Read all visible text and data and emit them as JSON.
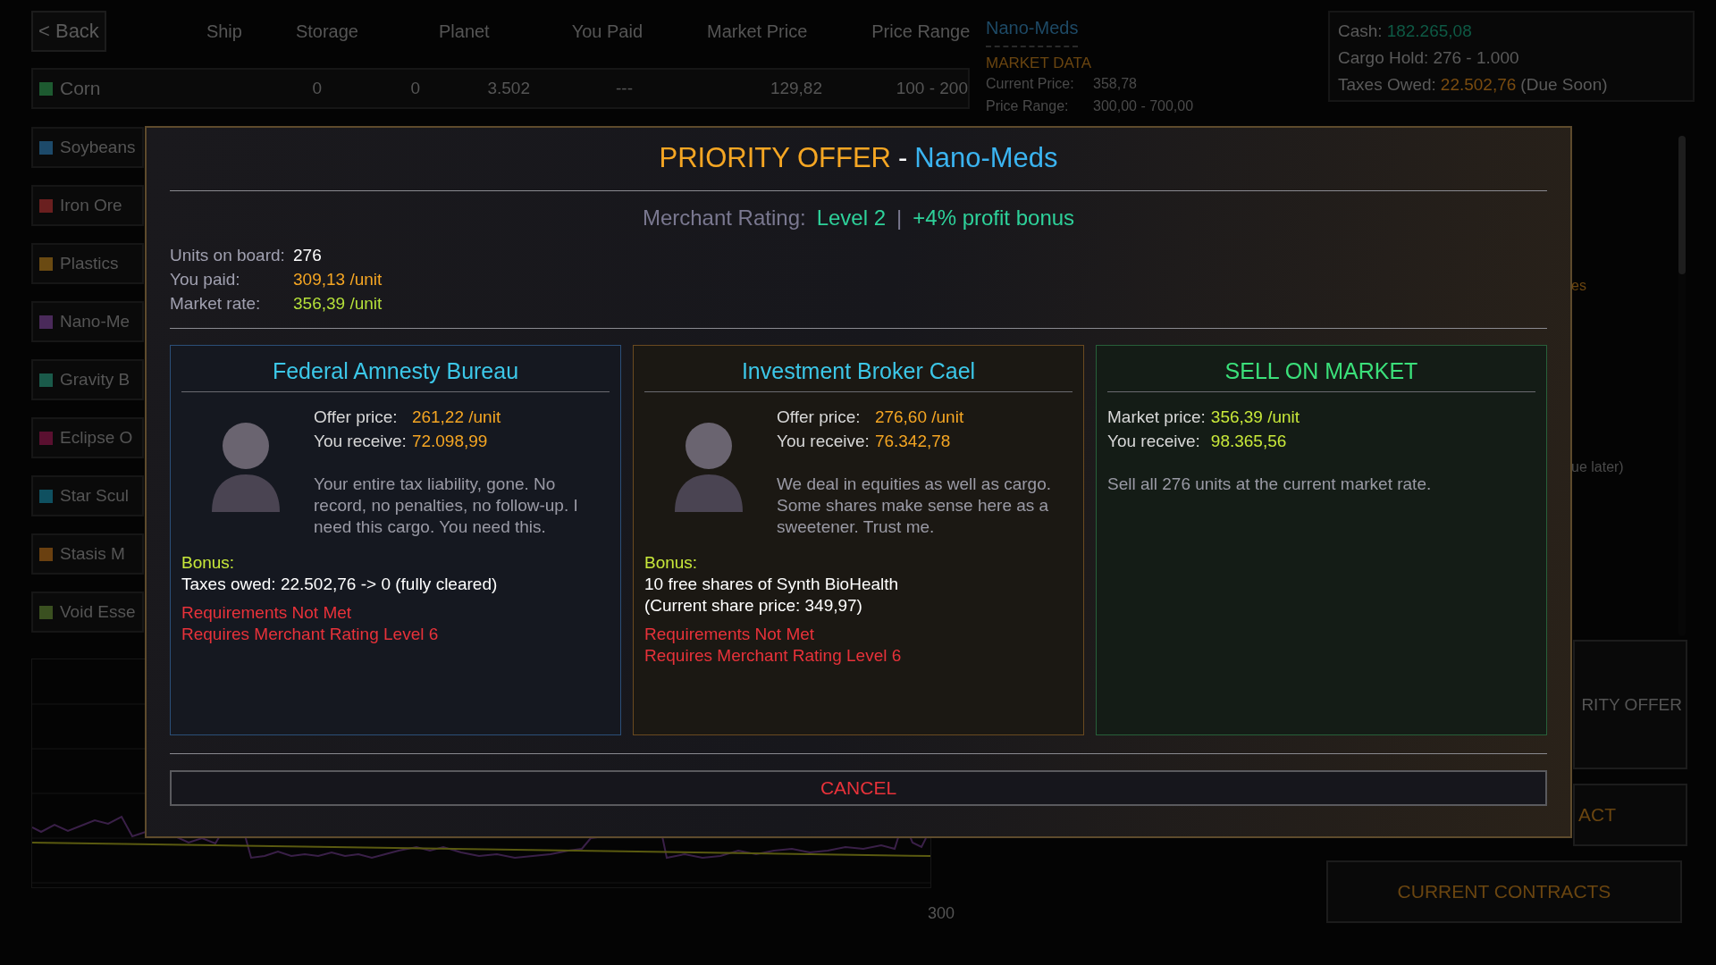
{
  "back_button": "< Back",
  "columns": [
    "Ship",
    "Storage",
    "Planet",
    "You Paid",
    "Market Price",
    "Price Range"
  ],
  "commodities": [
    {
      "name": "Corn",
      "color": "#1d5a30",
      "cells": [
        "0",
        "0",
        "3.502",
        "---",
        "129,82",
        "100 - 200"
      ]
    },
    {
      "name": "Soybeans",
      "color": "#1d4a6a"
    },
    {
      "name": "Iron Ore",
      "color": "#6a1f1f"
    },
    {
      "name": "Plastics",
      "color": "#6a4a12"
    },
    {
      "name": "Nano-Me",
      "color": "#4a2a5a"
    },
    {
      "name": "Gravity B",
      "color": "#1a5a4a"
    },
    {
      "name": "Eclipse O",
      "color": "#5a1030"
    },
    {
      "name": "Star Scul",
      "color": "#0f5060"
    },
    {
      "name": "Stasis M",
      "color": "#6a4010"
    },
    {
      "name": "Void Esse",
      "color": "#3a5020"
    }
  ],
  "market_data": {
    "title": "Nano-Meds",
    "heading": "MARKET DATA",
    "rows": [
      {
        "label": "Current Price:",
        "value": "358,78"
      },
      {
        "label": "Price Range:",
        "value": "300,00 - 700,00"
      }
    ]
  },
  "status": [
    {
      "label": "Cash:",
      "value": "182.265,08",
      "kind": "money"
    },
    {
      "label": "Cargo Hold:",
      "value": "276 - 1.000",
      "kind": "plain"
    },
    {
      "label": "Taxes Owed:",
      "value": "22.502,76",
      "suffix": "(Due Soon)",
      "kind": "warning"
    }
  ],
  "side_fragments": [
    "es",
    "ue later)"
  ],
  "side_buttons": [
    {
      "label": "RITY OFFER",
      "kind": "neutral"
    },
    {
      "label": "ACT",
      "kind": "accent"
    },
    {
      "label": "CURRENT CONTRACTS",
      "kind": "accent"
    }
  ],
  "chart_tick": "300",
  "modal": {
    "title": "PRIORITY OFFER",
    "separator": "-",
    "product": "Nano-Meds",
    "rating_label": "Merchant Rating:",
    "rating_level": "Level 2",
    "rating_divider": "|",
    "rating_bonus": "+4% profit bonus",
    "info": [
      {
        "label": "Units on board:",
        "value": "276",
        "kind": "plain"
      },
      {
        "label": "You paid:",
        "value": "309,13 /unit",
        "kind": "paid"
      },
      {
        "label": "Market rate:",
        "value": "356,39 /unit",
        "kind": "market"
      }
    ],
    "offers": [
      {
        "kind": "merchant",
        "title": "Federal Amnesty Bureau",
        "price_lines": [
          {
            "label": "Offer price:",
            "value": "261,22 /unit"
          },
          {
            "label": "You receive:",
            "value": "72.098,99"
          }
        ],
        "description": "Your entire tax liability, gone. No record, no penalties, no follow-up. I need this cargo. You need this.",
        "bonus_label": "Bonus:",
        "bonus_lines": [
          "Taxes owed: 22.502,76 -> 0 (fully cleared)"
        ],
        "requirements": [
          "Requirements Not Met",
          "Requires Merchant Rating Level 6"
        ]
      },
      {
        "kind": "merchant",
        "title": "Investment Broker Cael",
        "price_lines": [
          {
            "label": "Offer price:",
            "value": "276,60 /unit"
          },
          {
            "label": "You receive:",
            "value": "76.342,78"
          }
        ],
        "description": "We deal in equities as well as cargo. Some shares make sense here as a sweetener. Trust me.",
        "bonus_label": "Bonus:",
        "bonus_lines": [
          "10 free shares of Synth BioHealth",
          "(Current share price: 349,97)"
        ],
        "requirements": [
          "Requirements Not Met",
          "Requires Merchant Rating Level 6"
        ]
      },
      {
        "kind": "market",
        "title": "SELL ON MARKET",
        "price_lines": [
          {
            "label": "Market price:",
            "value": "356,39 /unit"
          },
          {
            "label": "You receive:",
            "value": "98.365,56"
          }
        ],
        "description": "Sell all 276 units at the current market rate."
      }
    ],
    "cancel": "CANCEL"
  }
}
